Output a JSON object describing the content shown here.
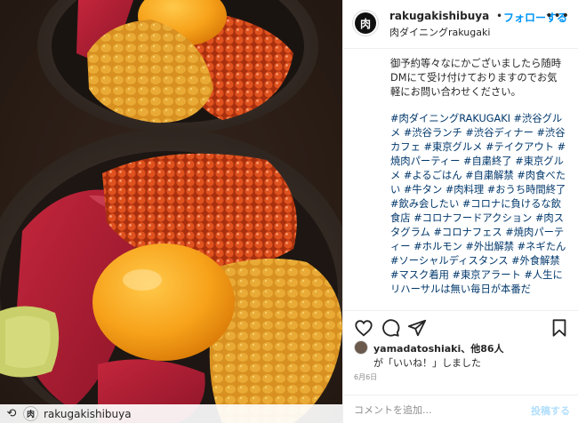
{
  "post": {
    "username": "rakugakishibuya",
    "separator": "•",
    "follow_label": "フォローする",
    "location": "肉ダイニングrakugaki",
    "more_label": "•••",
    "avatar_text": "肉"
  },
  "caption": {
    "body": "御予約等々なにかございましたら随時DMにて受け付けておりますのでお気軽にお問い合わせください。",
    "hashtags": "#肉ダイニングRAKUGAKI #渋谷グルメ #渋谷ランチ #渋谷ディナー #渋谷カフェ #東京グルメ #テイクアウト #焼肉パーティー #自粛終了 #東京グルメ #よるごはん #自粛解禁 #肉食べたい #牛タン #肉料理 #おうち時間終了 #飲み会したい #コロナに負けるな飲食店 #コロナフードアクション #肉スタグラム #コロナフェス #焼肉パーティー #ホルモン #外出解禁 #ネギたん #ソーシャルディスタンス #外食解禁 #マスク着用 #東京アラート #人生にリハーサルは無い毎日が本番だ"
  },
  "actions": {
    "heart": "heart-icon",
    "comment": "comment-icon",
    "share": "share-icon",
    "bookmark": "bookmark-icon"
  },
  "likes": {
    "user": "yamadatoshiaki、他86人",
    "text": "が「いいね！」しました"
  },
  "date": "6月6日",
  "comment": {
    "placeholder": "コメントを追加...",
    "post_label": "投稿する"
  },
  "repost": {
    "icon": "⟲",
    "avatar_text": "肉",
    "username": "rakugakishibuya"
  },
  "colors": {
    "link_blue": "#0095f6",
    "hashtag": "#00376b",
    "egg_yolk": "#f7a21a",
    "ikura": "#d84a1e",
    "uni": "#e0a12b",
    "beef": "#b8233a"
  }
}
